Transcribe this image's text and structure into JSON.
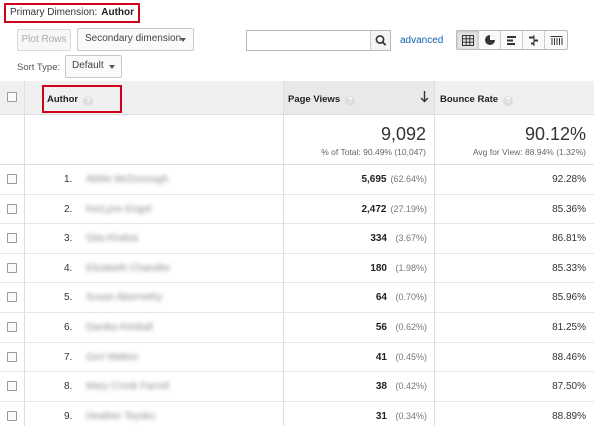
{
  "primary_dimension": {
    "label": "Primary Dimension:",
    "value": "Author"
  },
  "toolbar": {
    "plot_rows": "Plot Rows",
    "secondary_dimension": "Secondary dimension",
    "search_value": "",
    "advanced": "advanced",
    "sort_type_label": "Sort Type:",
    "sort_type_value": "Default"
  },
  "table": {
    "headers": {
      "author": "Author",
      "page_views": "Page Views",
      "bounce_rate": "Bounce Rate"
    },
    "totals": {
      "page_views": "9,092",
      "page_views_sub": "% of Total: 90.49% (10,047)",
      "bounce_rate": "90.12%",
      "bounce_rate_sub": "Avg for View: 88.94% (1.32%)"
    },
    "rows": [
      {
        "index": "1.",
        "author": "Abbie McDonough",
        "page_views": "5,695",
        "pct": "(62.64%)",
        "bounce_rate": "92.28%"
      },
      {
        "index": "2.",
        "author": "KerLynn Engel",
        "page_views": "2,472",
        "pct": "(27.19%)",
        "bounce_rate": "85.36%"
      },
      {
        "index": "3.",
        "author": "Gita Khalsa",
        "page_views": "334",
        "pct": "(3.67%)",
        "bounce_rate": "86.81%"
      },
      {
        "index": "4.",
        "author": "Elizabeth Chandler",
        "page_views": "180",
        "pct": "(1.98%)",
        "bounce_rate": "85.33%"
      },
      {
        "index": "5.",
        "author": "Susan Abernethy",
        "page_views": "64",
        "pct": "(0.70%)",
        "bounce_rate": "85.96%"
      },
      {
        "index": "6.",
        "author": "Danika Kimball",
        "page_views": "56",
        "pct": "(0.62%)",
        "bounce_rate": "81.25%"
      },
      {
        "index": "7.",
        "author": "Geri Walton",
        "page_views": "41",
        "pct": "(0.45%)",
        "bounce_rate": "88.46%"
      },
      {
        "index": "8.",
        "author": "Mary Cronk Farrell",
        "page_views": "38",
        "pct": "(0.42%)",
        "bounce_rate": "87.50%"
      },
      {
        "index": "9.",
        "author": "Heather Teysko",
        "page_views": "31",
        "pct": "(0.34%)",
        "bounce_rate": "88.89%"
      }
    ]
  },
  "colors": {
    "highlight": "#d0021b",
    "link": "#1a5fa8",
    "header_bg": "#f0f0f0"
  }
}
